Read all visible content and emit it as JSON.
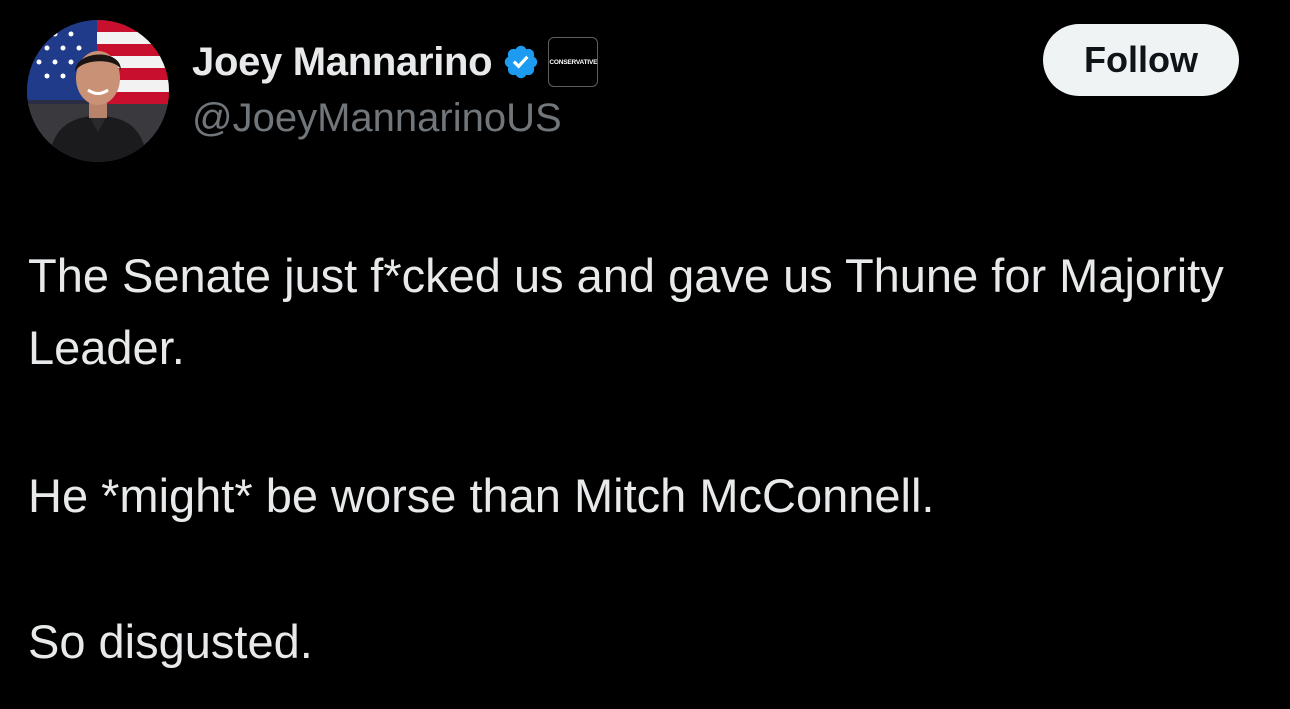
{
  "author": {
    "display_name": "Joey Mannarino",
    "handle": "@JoeyMannarinoUS",
    "verified_icon": "verified-check-icon",
    "verified_color": "#1d9bf0",
    "affiliation_badge_text": "CONSERVATIVE",
    "avatar": "profile-photo-with-american-flag-background"
  },
  "actions": {
    "follow_label": "Follow"
  },
  "tweet": {
    "paragraphs": [
      "The Senate just f*cked us and gave us Thune for Majority Leader.",
      "He *might* be worse than Mitch McConnell.",
      "So disgusted."
    ]
  },
  "colors": {
    "background": "#000000",
    "text_primary": "#e7e9ea",
    "text_secondary": "#71767b",
    "button_bg": "#eff3f4",
    "button_text": "#0f1419"
  }
}
